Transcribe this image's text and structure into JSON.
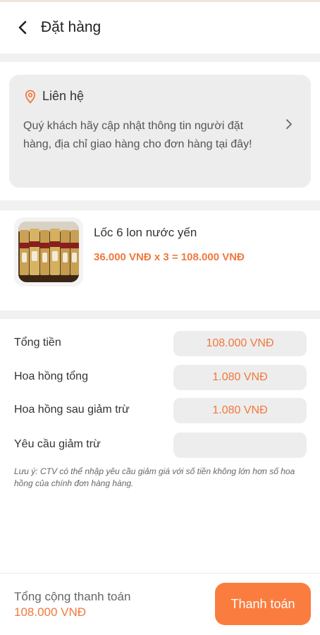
{
  "header": {
    "title": "Đặt hàng",
    "back_icon": "chevron-left-icon"
  },
  "contact": {
    "icon": "location-pin-icon",
    "title": "Liên hệ",
    "text": "Quý khách hãy cập nhật thông tin người đặt hàng, địa chỉ giao hàng cho đơn hàng tại đây!",
    "chevron_icon": "chevron-right-icon"
  },
  "product": {
    "name": "Lốc 6 lon nước yến",
    "price_line": "36.000 VNĐ x 3 = 108.000 VNĐ"
  },
  "summary": {
    "rows": [
      {
        "label": "Tổng tiền",
        "value": "108.000 VNĐ"
      },
      {
        "label": "Hoa hồng tổng",
        "value": "1.080 VNĐ"
      },
      {
        "label": "Hoa hồng sau giảm trừ",
        "value": "1.080 VNĐ"
      },
      {
        "label": "Yêu cầu giảm trừ",
        "value": ""
      }
    ],
    "note": "Lưu ý: CTV có thể nhập yêu cầu giảm giá với số tiền không lớn hơn số hoa hồng của chính đơn hàng hàng."
  },
  "footer": {
    "total_label": "Tổng cộng thanh toán",
    "total_value": "108.000 VNĐ",
    "pay_label": "Thanh toán"
  },
  "colors": {
    "accent": "#f0793d",
    "button": "#fa7c3f",
    "field_bg": "#ededed"
  }
}
